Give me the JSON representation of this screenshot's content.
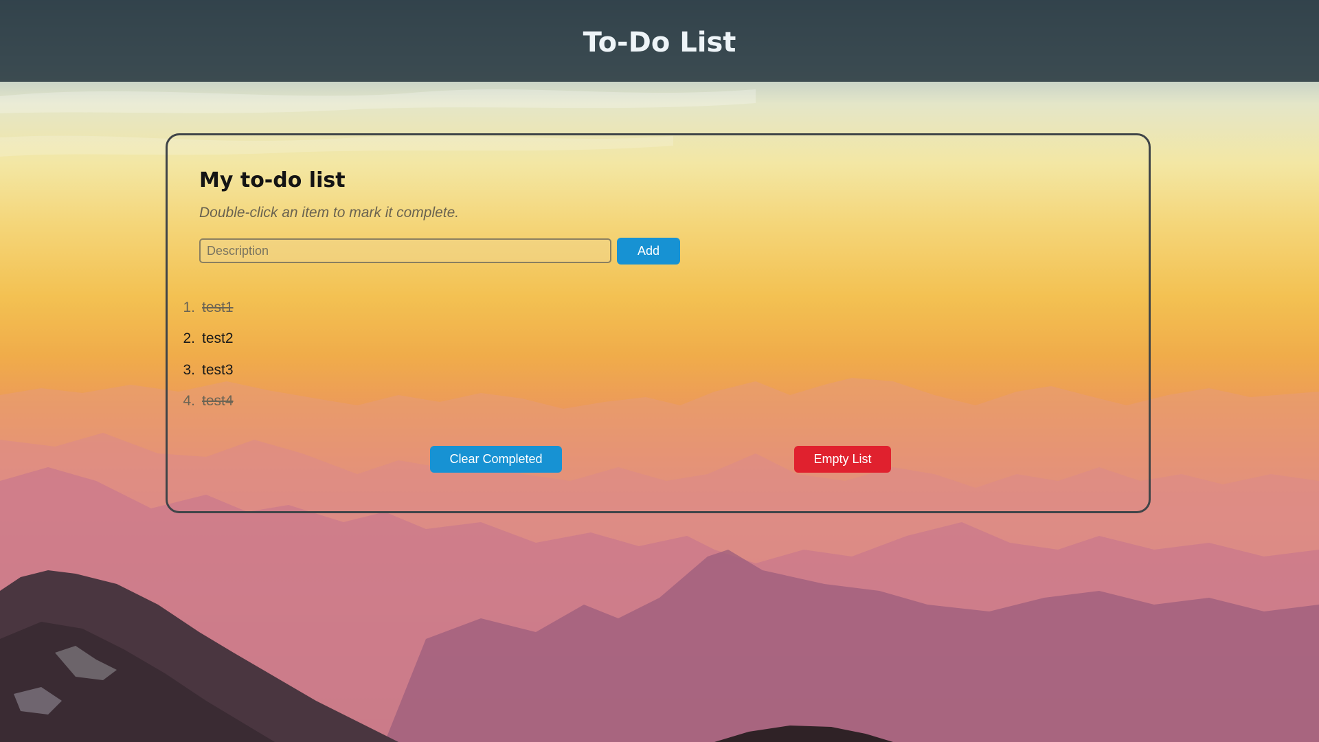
{
  "header": {
    "title": "To-Do List"
  },
  "card": {
    "heading": "My to-do list",
    "hint": "Double-click an item to mark it complete."
  },
  "form": {
    "description_value": "",
    "description_placeholder": "Description",
    "add_label": "Add"
  },
  "todos": [
    {
      "num": "1.",
      "text": "test1",
      "completed": true
    },
    {
      "num": "2.",
      "text": "test2",
      "completed": false
    },
    {
      "num": "3.",
      "text": "test3",
      "completed": false
    },
    {
      "num": "4.",
      "text": "test4",
      "completed": true
    }
  ],
  "actions": {
    "clear_completed_label": "Clear Completed",
    "empty_list_label": "Empty List"
  },
  "colors": {
    "header_bg": "#283840",
    "primary_button": "#1792d3",
    "danger_button": "#e0212e"
  }
}
